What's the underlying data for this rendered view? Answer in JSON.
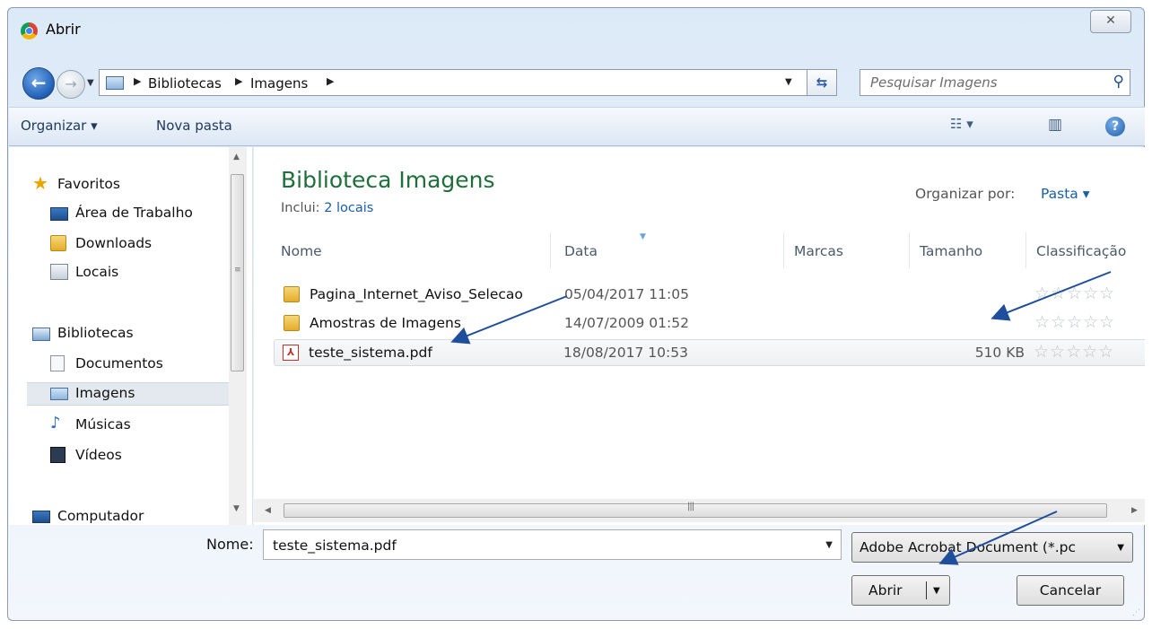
{
  "window": {
    "title": "Abrir",
    "close_glyph": "✕"
  },
  "address_bar": {
    "breadcrumbs": [
      "Bibliotecas",
      "Imagens"
    ],
    "search_placeholder": "Pesquisar Imagens"
  },
  "toolbar": {
    "organize_label": "Organizar ▾",
    "new_folder_label": "Nova pasta"
  },
  "nav": {
    "favorites": {
      "label": "Favoritos"
    },
    "items_fav": [
      {
        "label": "Área de Trabalho",
        "icon": "desktop-icon"
      },
      {
        "label": "Downloads",
        "icon": "downloads-folder-icon"
      },
      {
        "label": "Locais",
        "icon": "recent-places-icon"
      }
    ],
    "libraries": {
      "label": "Bibliotecas"
    },
    "items_lib": [
      {
        "label": "Documentos",
        "icon": "documents-icon"
      },
      {
        "label": "Imagens",
        "icon": "pictures-icon",
        "selected": true
      },
      {
        "label": "Músicas",
        "icon": "music-icon"
      },
      {
        "label": "Vídeos",
        "icon": "videos-icon"
      }
    ],
    "computer": {
      "label": "Computador"
    }
  },
  "content": {
    "library_title": "Biblioteca Imagens",
    "includes_label": "Inclui:",
    "includes_link": "2 locais",
    "sort_label": "Organizar por:",
    "sort_value": "Pasta ▾",
    "columns": [
      "Nome",
      "Data",
      "Marcas",
      "Tamanho",
      "Classificação"
    ],
    "files": [
      {
        "name": "Pagina_Internet_Aviso_Selecao",
        "date": "05/04/2017 11:05",
        "size": "",
        "type": "folder",
        "rating": "☆☆☆☆☆"
      },
      {
        "name": "Amostras de Imagens",
        "date": "14/07/2009 01:52",
        "size": "",
        "type": "folder",
        "rating": "☆☆☆☆☆"
      },
      {
        "name": "teste_sistema.pdf",
        "date": "18/08/2017 10:53",
        "size": "510 KB",
        "type": "pdf",
        "rating": "☆☆☆☆☆",
        "selected": true
      }
    ]
  },
  "bottom": {
    "name_label": "Nome:",
    "file_name_value": "teste_sistema.pdf",
    "file_type": "Adobe Acrobat Document (*.pc",
    "open_label": "Abrir",
    "cancel_label": "Cancelar"
  },
  "colors": {
    "accent_blue": "#1a5ea8",
    "library_title_green": "#1e6f3a",
    "annotation_arrow": "#1f4e9c"
  }
}
